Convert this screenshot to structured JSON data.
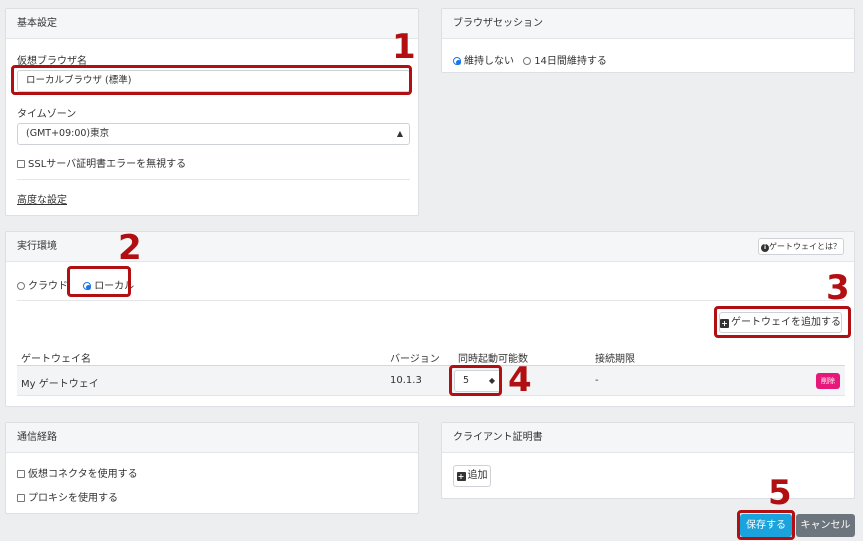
{
  "basic": {
    "title": "基本設定",
    "browser_name_label": "仮想ブラウザ名",
    "browser_name_value": "ローカルブラウザ (標準)",
    "timezone_label": "タイムゾーン",
    "timezone_value": "(GMT+09:00)東京",
    "ssl_label": "SSLサーバ証明書エラーを無視する",
    "advanced_link": "高度な設定"
  },
  "session": {
    "title": "ブラウザセッション",
    "opt_none": "維持しない",
    "opt_14": "14日間維持する"
  },
  "env": {
    "title": "実行環境",
    "help_label": "ゲートウェイとは？",
    "opt_cloud": "クラウド",
    "opt_local": "ローカル",
    "add_gateway": "ゲートウェイを追加する",
    "columns": [
      "ゲートウェイ名",
      "バージョン",
      "同時起動可能数",
      "接続期限"
    ],
    "row": {
      "name": "My ゲートウェイ",
      "version": "10.1.3",
      "concurrent": "5",
      "expiry": "-",
      "delete_label": "削除"
    }
  },
  "route": {
    "title": "通信経路",
    "connector_label": "仮想コネクタを使用する",
    "proxy_label": "プロキシを使用する"
  },
  "cert": {
    "title": "クライアント証明書",
    "add_label": "追加"
  },
  "footer": {
    "save": "保存する",
    "cancel": "キャンセル"
  },
  "annotations": [
    "1",
    "2",
    "3",
    "4",
    "5"
  ],
  "colors": {
    "annotation_red": "#b10f12",
    "save_blue": "#1aa3dd",
    "cancel_gray": "#6c757d",
    "delete_pink": "#e6197a",
    "radio_blue": "#1a73e8"
  }
}
